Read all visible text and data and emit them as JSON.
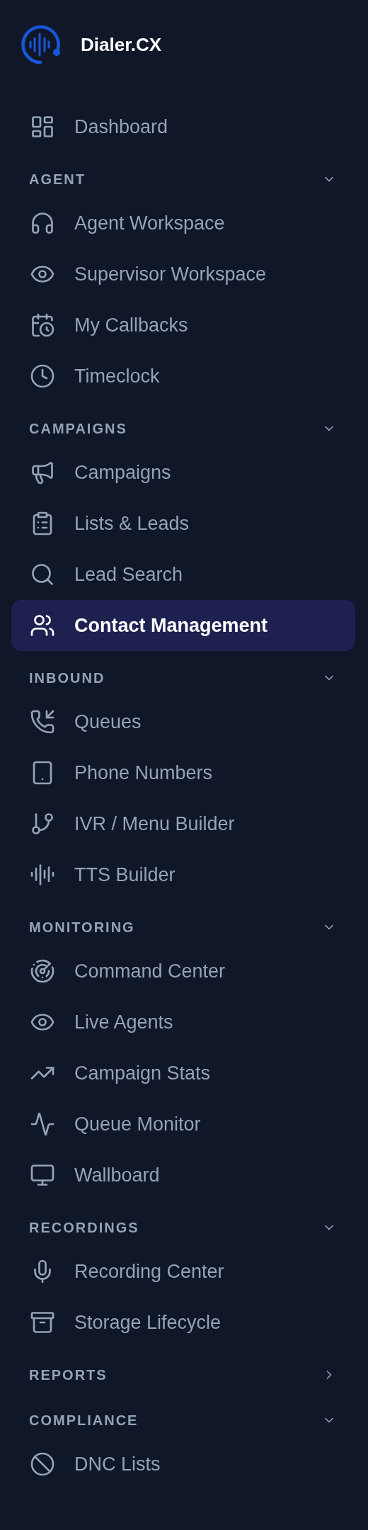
{
  "brand": {
    "name": "Dialer.CX"
  },
  "top_items": [
    {
      "label": "Dashboard",
      "selected": false
    }
  ],
  "sections": [
    {
      "title": "AGENT",
      "expanded": true,
      "items": [
        {
          "label": "Agent Workspace",
          "selected": false
        },
        {
          "label": "Supervisor Workspace",
          "selected": false
        },
        {
          "label": "My Callbacks",
          "selected": false
        },
        {
          "label": "Timeclock",
          "selected": false
        }
      ]
    },
    {
      "title": "CAMPAIGNS",
      "expanded": true,
      "items": [
        {
          "label": "Campaigns",
          "selected": false
        },
        {
          "label": "Lists & Leads",
          "selected": false
        },
        {
          "label": "Lead Search",
          "selected": false
        },
        {
          "label": "Contact Management",
          "selected": true
        }
      ]
    },
    {
      "title": "INBOUND",
      "expanded": true,
      "items": [
        {
          "label": "Queues",
          "selected": false
        },
        {
          "label": "Phone Numbers",
          "selected": false
        },
        {
          "label": "IVR / Menu Builder",
          "selected": false
        },
        {
          "label": "TTS Builder",
          "selected": false
        }
      ]
    },
    {
      "title": "MONITORING",
      "expanded": true,
      "items": [
        {
          "label": "Command Center",
          "selected": false
        },
        {
          "label": "Live Agents",
          "selected": false
        },
        {
          "label": "Campaign Stats",
          "selected": false
        },
        {
          "label": "Queue Monitor",
          "selected": false
        },
        {
          "label": "Wallboard",
          "selected": false
        }
      ]
    },
    {
      "title": "RECORDINGS",
      "expanded": true,
      "items": [
        {
          "label": "Recording Center",
          "selected": false
        },
        {
          "label": "Storage Lifecycle",
          "selected": false
        }
      ]
    },
    {
      "title": "REPORTS",
      "expanded": false
    },
    {
      "title": "COMPLIANCE",
      "expanded": true,
      "items": [
        {
          "label": "DNC Lists",
          "selected": false
        }
      ]
    }
  ]
}
